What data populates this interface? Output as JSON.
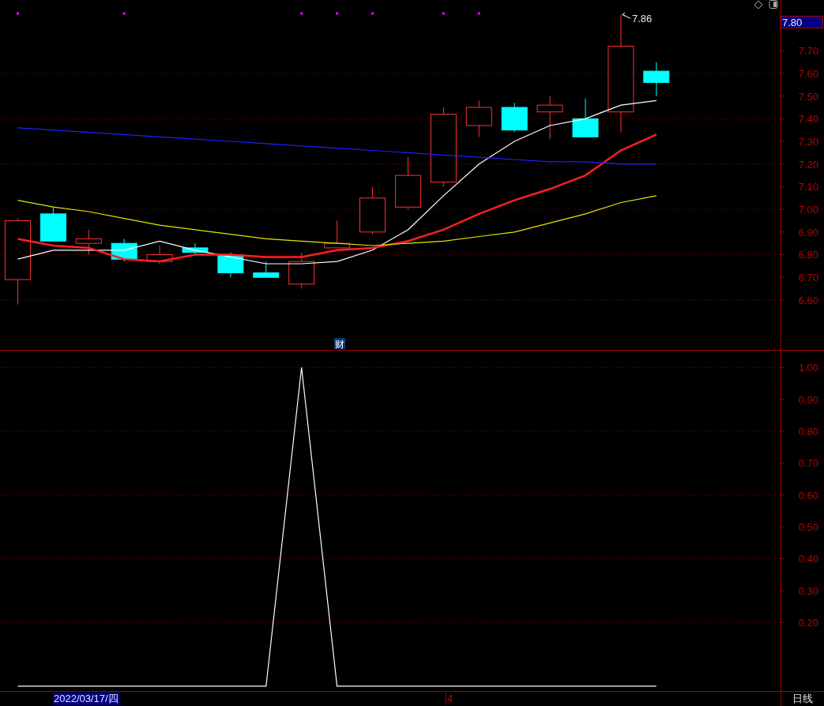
{
  "price_chart": {
    "current_price": "7.80",
    "high_label": "7.86",
    "finance_badge": "财",
    "signal_marks": [
      {
        "marked": true
      },
      {
        "marked": false
      },
      {
        "marked": false
      },
      {
        "marked": true
      },
      {
        "marked": false
      },
      {
        "marked": false
      },
      {
        "marked": false
      },
      {
        "marked": false
      },
      {
        "marked": true
      },
      {
        "marked": true
      },
      {
        "marked": true
      },
      {
        "marked": false
      },
      {
        "marked": true
      },
      {
        "marked": true
      },
      {
        "marked": false
      },
      {
        "marked": false
      },
      {
        "marked": false
      },
      {
        "marked": false
      },
      {
        "marked": false
      }
    ],
    "chart_data": {
      "type": "line",
      "grid": true,
      "categories": [
        null,
        null,
        null,
        null,
        null,
        null,
        null,
        null,
        null,
        null,
        null,
        null,
        null,
        null,
        null,
        null,
        null,
        null,
        null,
        null,
        null,
        null
      ],
      "ylim": [
        6.38,
        7.924
      ],
      "yticks": [
        {
          "value": 6.6,
          "label": "6.60"
        },
        {
          "value": 6.7,
          "label": "6.70"
        },
        {
          "value": 6.8,
          "label": "6.80"
        },
        {
          "value": 6.9,
          "label": "6.90"
        },
        {
          "value": 7.0,
          "label": "7.00"
        },
        {
          "value": 7.1,
          "label": "7.10"
        },
        {
          "value": 7.2,
          "label": "7.20"
        },
        {
          "value": 7.3,
          "label": "7.30"
        },
        {
          "value": 7.4,
          "label": "7.40"
        },
        {
          "value": 7.5,
          "label": "7.50"
        },
        {
          "value": 7.6,
          "label": "7.60"
        },
        {
          "value": 7.7,
          "label": "7.70"
        }
      ],
      "series": [
        {
          "type": "candlestick",
          "ohlc": [
            [
              6.69,
              6.96,
              6.58,
              6.95
            ],
            [
              6.98,
              7.01,
              6.86,
              6.86
            ],
            [
              6.85,
              6.91,
              6.8,
              6.87
            ],
            [
              6.85,
              6.87,
              6.77,
              6.78
            ],
            [
              6.77,
              6.84,
              6.76,
              6.8
            ],
            [
              6.83,
              6.85,
              6.8,
              6.81
            ],
            [
              6.8,
              6.81,
              6.7,
              6.72
            ],
            [
              6.72,
              6.77,
              6.7,
              6.7
            ],
            [
              6.67,
              6.81,
              6.65,
              6.77
            ],
            [
              6.83,
              6.95,
              6.83,
              6.85
            ],
            [
              6.9,
              7.1,
              6.89,
              7.05
            ],
            [
              7.01,
              7.23,
              7.0,
              7.15
            ],
            [
              7.12,
              7.45,
              7.1,
              7.42
            ],
            [
              7.37,
              7.48,
              7.32,
              7.45
            ],
            [
              7.45,
              7.47,
              7.34,
              7.35
            ],
            [
              7.43,
              7.5,
              7.31,
              7.46
            ],
            [
              7.4,
              7.49,
              7.32,
              7.32
            ],
            [
              7.43,
              7.86,
              7.34,
              7.72
            ],
            [
              7.61,
              7.65,
              7.5,
              7.56
            ],
            null,
            null,
            null
          ]
        },
        {
          "color": "#ffffff",
          "values": [
            6.78,
            6.82,
            6.82,
            6.82,
            6.86,
            6.82,
            6.79,
            6.76,
            6.76,
            6.77,
            6.82,
            6.91,
            7.06,
            7.2,
            7.3,
            7.37,
            7.4,
            7.46,
            7.48,
            null,
            null,
            null
          ]
        },
        {
          "color": "#ff2020",
          "values": [
            6.87,
            6.84,
            6.83,
            6.78,
            6.77,
            6.8,
            6.8,
            6.79,
            6.79,
            6.82,
            6.83,
            6.86,
            6.91,
            6.98,
            7.04,
            7.09,
            7.15,
            7.26,
            7.33,
            null,
            null,
            null
          ]
        },
        {
          "color": "#e6e600",
          "values": [
            7.04,
            7.01,
            6.99,
            6.96,
            6.93,
            6.91,
            6.89,
            6.87,
            6.86,
            6.85,
            6.84,
            6.85,
            6.86,
            6.88,
            6.9,
            6.94,
            6.98,
            7.03,
            7.06,
            null,
            null,
            null
          ]
        },
        {
          "color": "#2020ff",
          "values": [
            7.36,
            7.35,
            7.34,
            7.33,
            7.32,
            7.31,
            7.3,
            7.29,
            7.28,
            7.27,
            7.26,
            7.25,
            7.24,
            7.23,
            7.22,
            7.21,
            7.21,
            7.2,
            7.2,
            null,
            null,
            null
          ]
        }
      ]
    }
  },
  "indicator_chart": {
    "chart_data": {
      "type": "line",
      "grid": true,
      "categories": [
        null,
        null,
        null,
        null,
        null,
        null,
        null,
        null,
        null,
        null,
        null,
        null,
        null,
        null,
        null,
        null,
        null,
        null,
        null,
        null,
        null,
        null
      ],
      "ylim": [
        -0.015,
        1.055
      ],
      "yticks": [
        {
          "value": 0.2,
          "label": "0.20"
        },
        {
          "value": 0.3,
          "label": "0.30"
        },
        {
          "value": 0.4,
          "label": "0.40"
        },
        {
          "value": 0.5,
          "label": "0.50"
        },
        {
          "value": 0.6,
          "label": "0.60"
        },
        {
          "value": 0.7,
          "label": "0.70"
        },
        {
          "value": 0.8,
          "label": "0.80"
        },
        {
          "value": 0.9,
          "label": "0.90"
        },
        {
          "value": 1.0,
          "label": "1.00"
        }
      ],
      "series": [
        {
          "color": "#ffffff",
          "values": [
            0,
            0,
            0,
            0,
            0,
            0,
            0,
            0,
            1,
            0,
            0,
            0,
            0,
            0,
            0,
            0,
            0,
            0,
            0,
            null,
            null,
            null
          ]
        }
      ]
    }
  },
  "status_bar": {
    "date": "2022/03/17/四",
    "month_label": "4",
    "period": "日线"
  }
}
